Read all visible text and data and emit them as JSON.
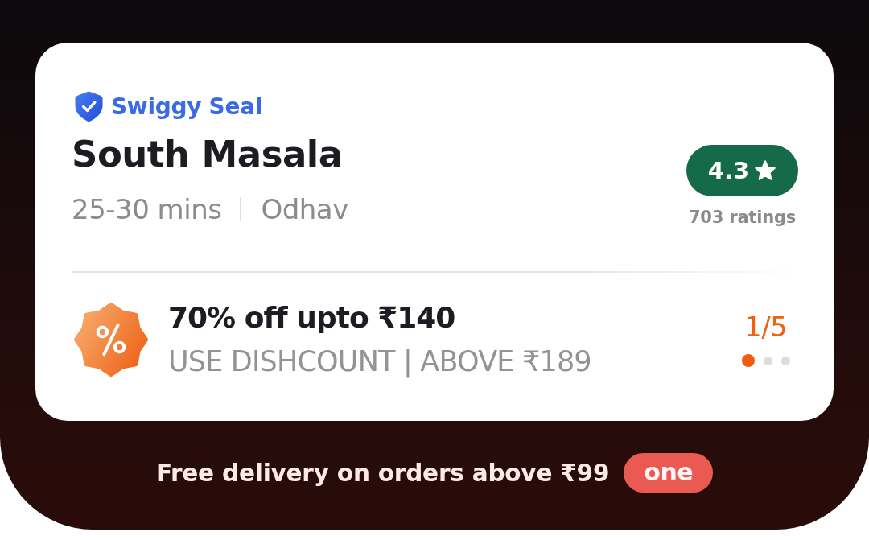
{
  "seal": {
    "label": "Swiggy Seal"
  },
  "restaurant": {
    "name": "South Masala",
    "delivery_time": "25-30 mins",
    "locality": "Odhav"
  },
  "rating": {
    "score": "4.3",
    "count": "703 ratings"
  },
  "offer": {
    "title": "70% off upto ₹140",
    "details": "USE DISHCOUNT | ABOVE ₹189",
    "position": "1/5",
    "pages": [
      {
        "selected": true
      },
      {
        "selected": false
      },
      {
        "selected": false
      }
    ]
  },
  "footer": {
    "text": "Free delivery on orders above ₹99",
    "badge": "one"
  }
}
